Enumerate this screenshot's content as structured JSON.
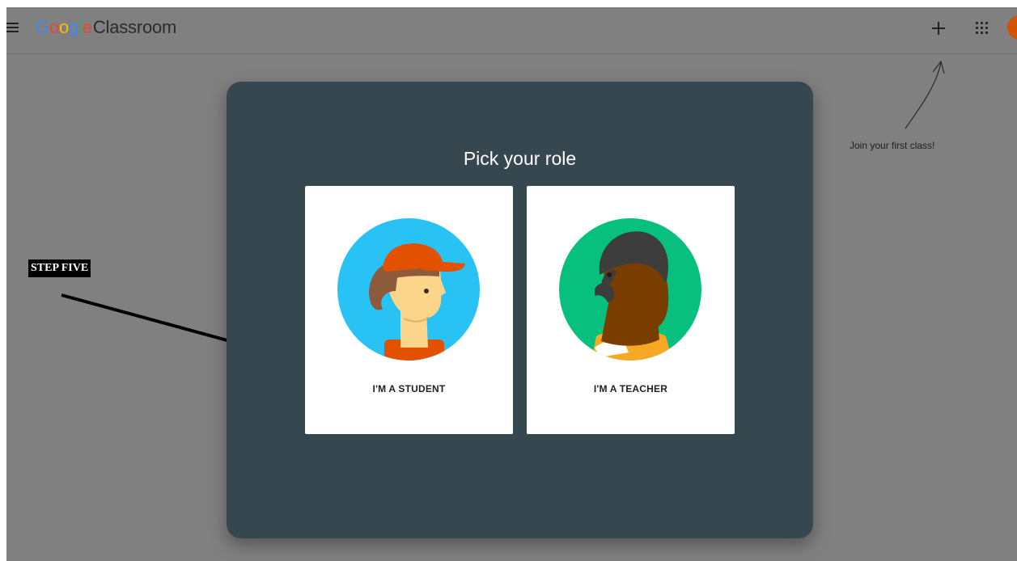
{
  "header": {
    "app_name_google": "Google",
    "app_name_product": "Classroom",
    "logo_colors": [
      "#4285F4",
      "#EA4335",
      "#FBBC05",
      "#4285F4",
      "#34A853",
      "#EA4335"
    ],
    "add_icon": "plus-icon",
    "apps_icon": "apps-grid-icon",
    "avatar_color": "#d35400"
  },
  "hint": {
    "text": "Join your first class!"
  },
  "annotation": {
    "step_label": "STEP FIVE"
  },
  "dialog": {
    "title": "Pick your role",
    "background": "#37474f",
    "roles": [
      {
        "label": "I'M A STUDENT",
        "illustration": "student-illustration"
      },
      {
        "label": "I'M A TEACHER",
        "illustration": "teacher-illustration"
      }
    ]
  }
}
